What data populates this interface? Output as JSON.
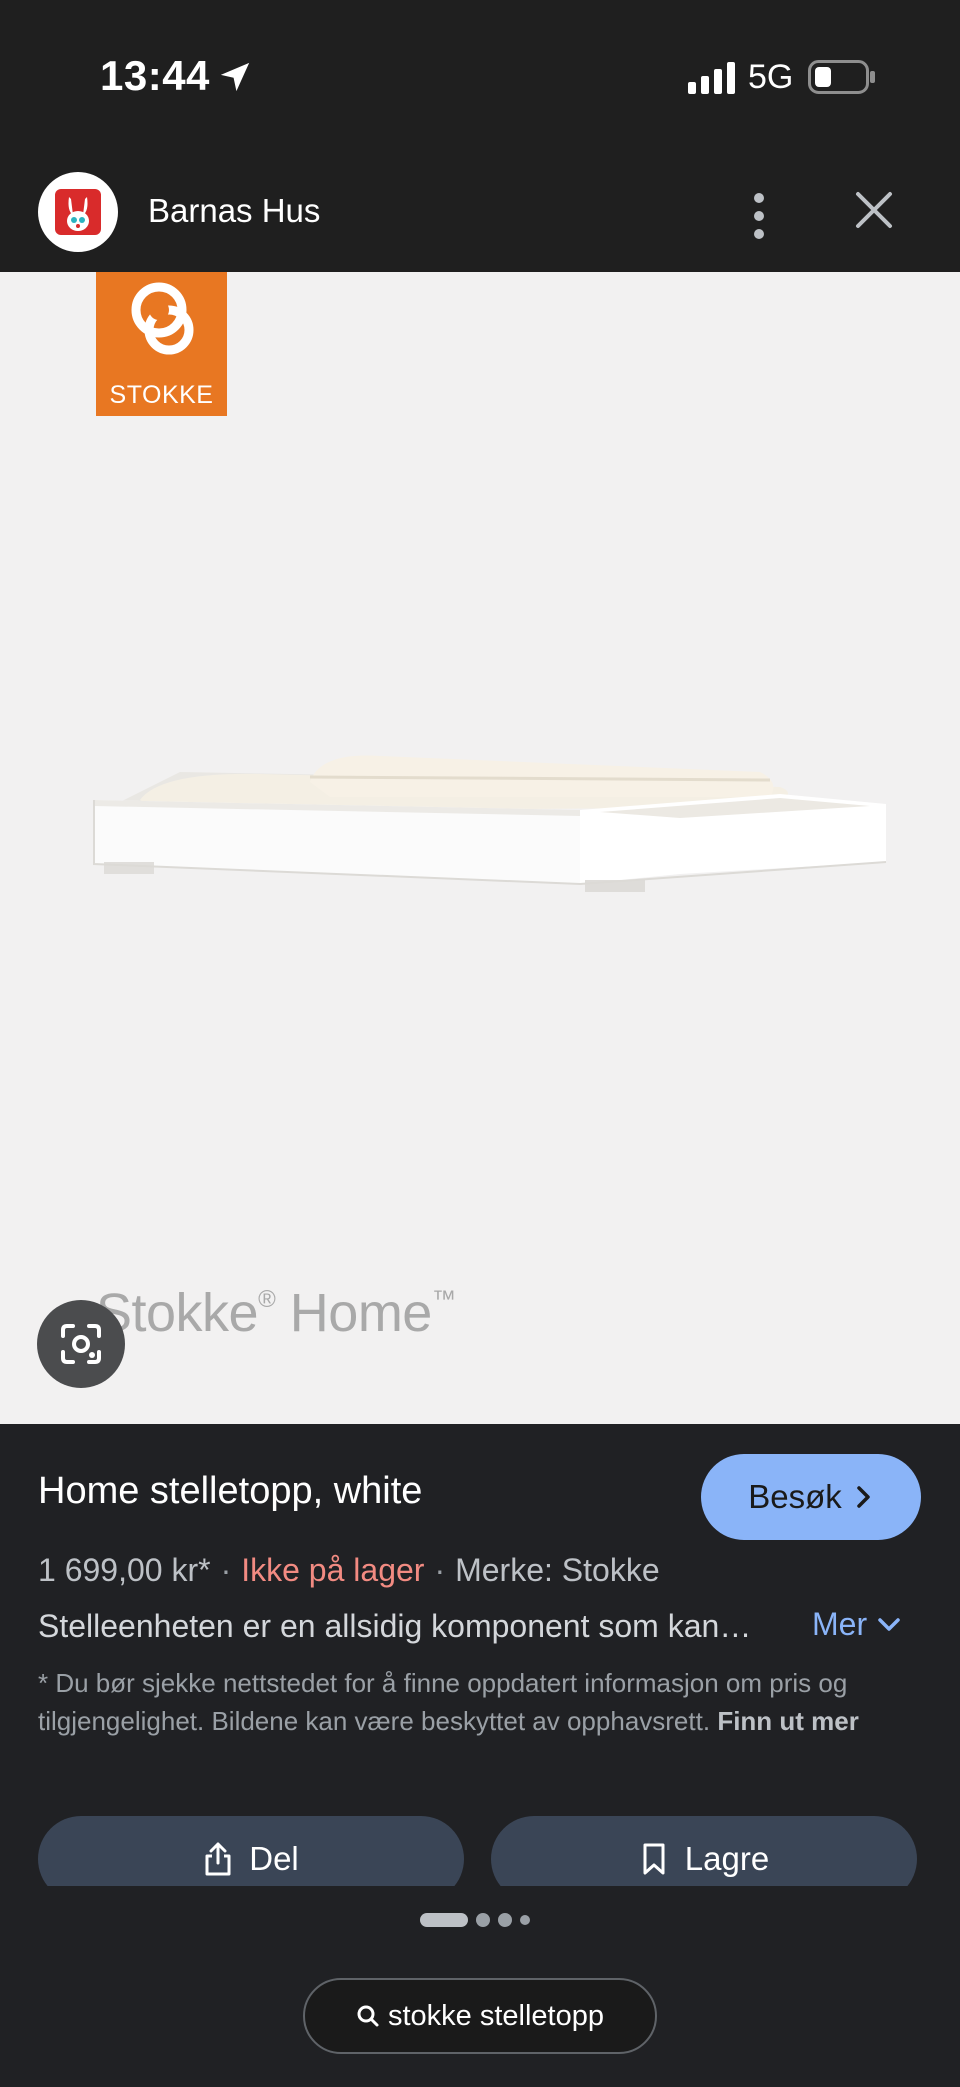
{
  "status_bar": {
    "time": "13:44",
    "network": "5G"
  },
  "appbar": {
    "site_name": "Barnas Hus"
  },
  "image": {
    "brand_logo_text": "STOKKE",
    "watermark_brand": "Stokke",
    "watermark_reg": "®",
    "watermark_product": "Home",
    "watermark_tm": "™"
  },
  "product": {
    "title": "Home stelletopp, white",
    "visit_label": "Besøk",
    "price": "1 699,00 kr*",
    "stock_status": "Ikke på lager",
    "brand": "Merke: Stokke",
    "description": "Stelleenheten er en allsidig komponent som kan…",
    "more_label": "Mer",
    "disclaimer_text": "* Du bør sjekke nettstedet for å finne oppdatert informasjon om pris og tilgjengelighet. Bildene kan være beskyttet av opphavsrett.",
    "disclaimer_link": "Finn ut mer"
  },
  "actions": {
    "share_label": "Del",
    "save_label": "Lagre"
  },
  "pagination": {
    "total": 4,
    "active_index": 0
  },
  "search_chip": {
    "query": "stokke stelletopp"
  },
  "colors": {
    "accent": "#8ab4f8",
    "stock_warning": "#f28b82",
    "stokke_orange": "#e87722",
    "button_bg": "#3a4556"
  }
}
